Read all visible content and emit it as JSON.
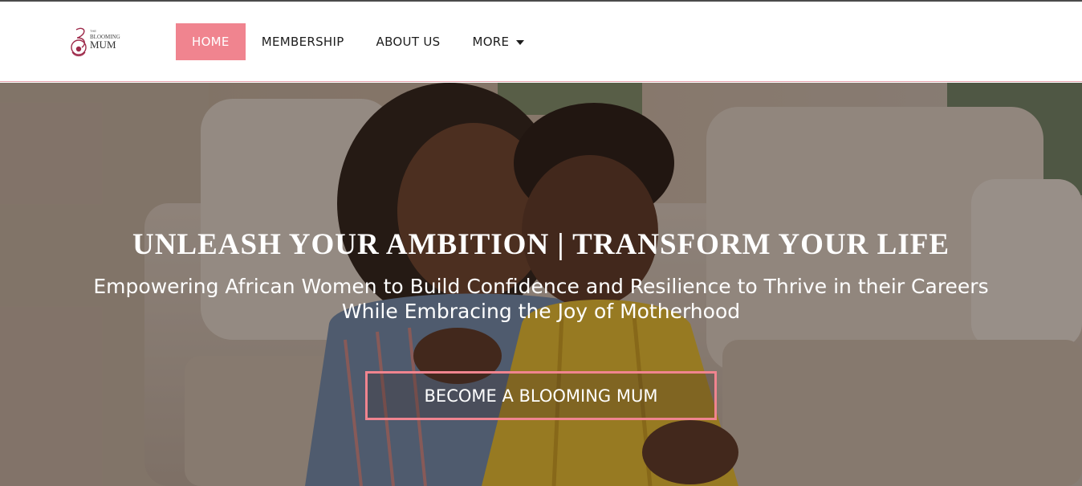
{
  "brand": {
    "logo_small_text": "THE",
    "logo_mid_text": "BLOOMING",
    "logo_main_text": "MUM",
    "accent_color": "#f0848f",
    "logo_color": "#9e2a4a"
  },
  "nav": {
    "items": [
      {
        "label": "HOME",
        "active": true
      },
      {
        "label": "MEMBERSHIP",
        "active": false
      },
      {
        "label": "ABOUT US",
        "active": false
      },
      {
        "label": "MORE",
        "active": false,
        "icon": "caret-down-icon"
      }
    ]
  },
  "hero": {
    "title": "UNLEASH YOUR AMBITION | TRANSFORM YOUR LIFE",
    "subtitle": "Empowering African Women to Build Confidence and Resilience to Thrive in their Careers While Embracing the Joy of Motherhood",
    "cta_label": "BECOME A BLOOMING MUM",
    "image_alt": "mother-and-baby-photo"
  }
}
